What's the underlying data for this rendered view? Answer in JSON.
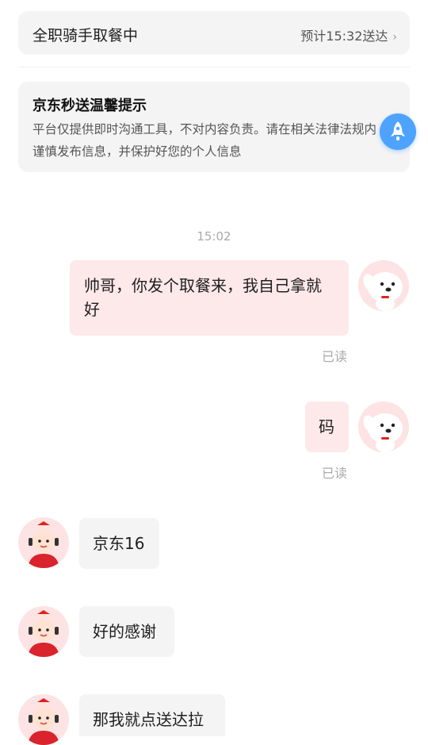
{
  "order_status": {
    "title": "全职骑手取餐中",
    "eta": "预计15:32送达",
    "chevron": "›"
  },
  "tip": {
    "title": "京东秒送温馨提示",
    "body": "平台仅提供即时沟通工具，不对内容负责。请在相关法律法规内谨慎发布信息，并保护好您的个人信息"
  },
  "float_button": {
    "icon": "rocket-icon",
    "color": "#4da3ff"
  },
  "chat": {
    "timestamp": "15:02",
    "messages": [
      {
        "side": "me",
        "text": "帅哥，你发个取餐来，我自己拿就好",
        "status": "已读",
        "avatar": "jd-dog-avatar"
      },
      {
        "side": "me",
        "text": "码",
        "status": "已读",
        "avatar": "jd-dog-avatar"
      },
      {
        "side": "rider",
        "text": "京东16",
        "avatar": "rider-avatar"
      },
      {
        "side": "rider",
        "text": "好的感谢",
        "avatar": "rider-avatar"
      },
      {
        "side": "rider",
        "text": "那我就点送达拉",
        "avatar": "rider-avatar"
      }
    ]
  },
  "colors": {
    "outgoing_bubble": "#fde8ea",
    "incoming_bubble": "#f4f4f4",
    "card_bg": "#f4f4f4"
  }
}
